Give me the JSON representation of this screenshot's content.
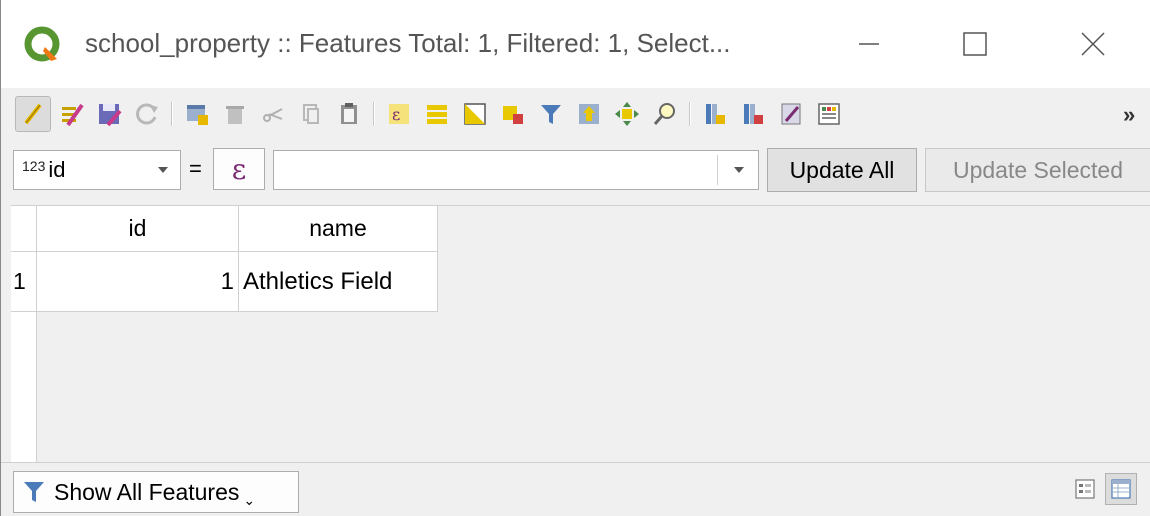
{
  "window": {
    "title": "school_property :: Features Total: 1, Filtered: 1, Select..."
  },
  "toolbar": {
    "more": "»",
    "buttons": [
      "toggle-editing-icon",
      "multi-edit-icon",
      "save-edits-icon",
      "reload-table-icon",
      "add-feature-icon",
      "delete-feature-icon",
      "cut-icon",
      "copy-icon",
      "paste-icon",
      "select-by-expression-icon",
      "select-all-icon",
      "invert-selection-icon",
      "deselect-all-icon",
      "filter-select-icon",
      "move-selection-top-icon",
      "pan-to-selection-icon",
      "zoom-to-selection-icon",
      "new-field-icon",
      "delete-field-icon",
      "field-calculator-icon",
      "conditional-formatting-icon"
    ]
  },
  "calculator": {
    "field_type": "123",
    "field_name": "id",
    "equals": "=",
    "expression_symbol": "ε",
    "expression_value": "",
    "update_all": "Update All",
    "update_selected": "Update Selected"
  },
  "table": {
    "columns": [
      "id",
      "name"
    ],
    "rows": [
      {
        "row_number": "1",
        "id": "1",
        "name": "Athletics Field"
      }
    ]
  },
  "bottombar": {
    "filter_label": "Show All Features",
    "filter_caret": "⌄"
  },
  "colors": {
    "qgis_green": "#589632",
    "qgis_yellow": "#ee7913",
    "edit_pencil": "#e8b800",
    "expression_purple": "#7a2a70"
  }
}
